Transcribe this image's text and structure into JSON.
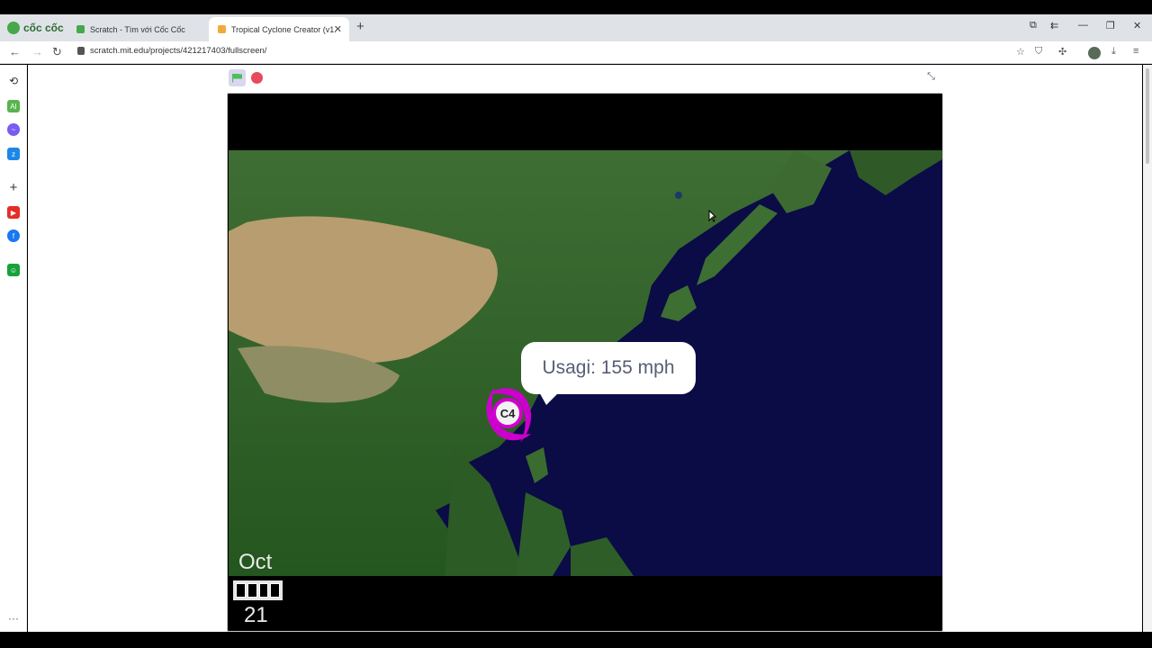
{
  "browser": {
    "brand": "cốc cốc",
    "tabs": [
      {
        "title": "Scratch - Tìm với Cốc Cốc",
        "active": false
      },
      {
        "title": "Tropical Cyclone Creator (v1.",
        "active": true
      }
    ],
    "new_tab_label": "+",
    "url": "scratch.mit.edu/projects/421217403/fullscreen/"
  },
  "icons": {
    "back": "back-arrow-icon",
    "forward": "forward-arrow-icon",
    "reload": "reload-icon",
    "star": "star-icon",
    "shield": "shield-icon",
    "extensions": "puzzle-icon",
    "downloads": "download-icon",
    "menu": "hamburger-icon"
  },
  "sidebar": {
    "items": [
      "history",
      "ai",
      "messenger",
      "zalo",
      "add",
      "youtube",
      "facebook",
      "sticker"
    ],
    "more_label": "···"
  },
  "scratch": {
    "green_flag": "green-flag-icon",
    "stop": "stop-icon",
    "exit_fullscreen": "exit-fullscreen-icon",
    "stage": {
      "month": "Oct",
      "day": "21",
      "bubble": "Usagi: 155 mph",
      "storm_category": "C4"
    }
  },
  "colors": {
    "ocean": "#0b0b46",
    "storm": "#d300d0",
    "flag": "#4cbf56",
    "stop": "#e8495c"
  }
}
